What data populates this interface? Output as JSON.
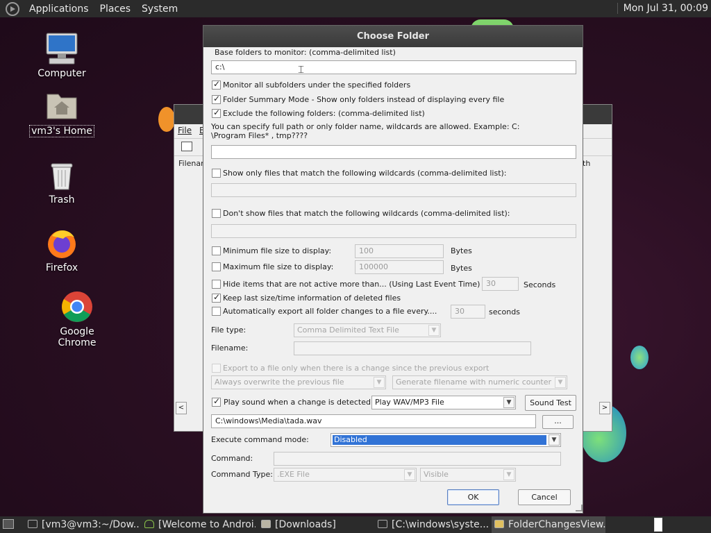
{
  "top_panel": {
    "menus": [
      "Applications",
      "Places",
      "System"
    ],
    "clock": "Mon Jul 31, 00:09"
  },
  "desktop": {
    "icons": [
      {
        "label": "Computer",
        "icon": "computer-icon"
      },
      {
        "label": "vm3's Home",
        "icon": "home-folder-icon"
      },
      {
        "label": "Trash",
        "icon": "trash-icon"
      },
      {
        "label": "Firefox",
        "icon": "firefox-icon"
      },
      {
        "label": "Google Chrome",
        "icon": "chrome-icon"
      }
    ]
  },
  "background_window": {
    "menu_file": "File",
    "menu_edit_partial": "E",
    "col_filename": "Filenam",
    "col_right_partial": "th"
  },
  "dialog": {
    "title": "Choose Folder",
    "base_folders_label": "Base folders to monitor:  (comma-delimited list)",
    "base_folders_value": "c:\\",
    "monitor_subfolders": {
      "label": "Monitor all subfolders under the specified folders",
      "checked": true
    },
    "folder_summary": {
      "label": "Folder Summary Mode - Show only folders instead of displaying every file",
      "checked": true
    },
    "exclude_folders": {
      "label": "Exclude the following folders: (comma-delimited list)",
      "checked": true
    },
    "exclude_help_line1": "You can specify full path or only folder name, wildcards are allowed. Example: C:",
    "exclude_help_line2": "\\Program Files* , tmp????",
    "exclude_value": "",
    "show_only_wildcards": {
      "label": "Show only files that match the following wildcards (comma-delimited list):",
      "checked": false,
      "value": ""
    },
    "dont_show_wildcards": {
      "label": "Don't show files that match the following wildcards (comma-delimited list):",
      "checked": false,
      "value": ""
    },
    "min_size": {
      "label": "Minimum file size to display:",
      "checked": false,
      "value": "100",
      "unit": "Bytes"
    },
    "max_size": {
      "label": "Maximum file size to display:",
      "checked": false,
      "value": "100000",
      "unit": "Bytes"
    },
    "hide_inactive": {
      "label": "Hide items that are not active more than... (Using Last Event Time)",
      "checked": false,
      "value": "30",
      "unit": "Seconds"
    },
    "keep_deleted": {
      "label": "Keep last size/time information of deleted files",
      "checked": true
    },
    "auto_export": {
      "label": "Automatically export all folder changes to a file every....",
      "checked": false,
      "value": "30",
      "unit": "seconds"
    },
    "file_type_label": "File type:",
    "file_type_value": "Comma Delimited Text File",
    "filename_label": "Filename:",
    "filename_value": "",
    "export_only_change": {
      "label": "Export to a file only when there is a change since the previous export",
      "checked": false
    },
    "overwrite_mode": "Always overwrite the previous file",
    "filename_mode": "Generate filename with numeric counter",
    "play_sound": {
      "label": "Play sound when a change is detected:",
      "checked": true
    },
    "sound_type": "Play WAV/MP3 File",
    "sound_test_button": "Sound Test",
    "sound_file": "C:\\windows\\Media\\tada.wav",
    "browse_button": "...",
    "exec_mode_label": "Execute command mode:",
    "exec_mode_value": "Disabled",
    "command_label": "Command:",
    "command_value": "",
    "command_type_label": "Command Type:",
    "command_type_value": ".EXE File",
    "window_mode_value": "Visible",
    "ok_button": "OK",
    "cancel_button": "Cancel"
  },
  "taskbar": {
    "tasks": [
      {
        "label": "[vm3@vm3:~/Dow...",
        "active": false
      },
      {
        "label": "[Welcome to Androi...",
        "active": false
      },
      {
        "label": "[Downloads]",
        "active": false
      },
      {
        "label": "[C:\\windows\\syste...",
        "active": false
      },
      {
        "label": "FolderChangesView...",
        "active": true
      }
    ]
  }
}
